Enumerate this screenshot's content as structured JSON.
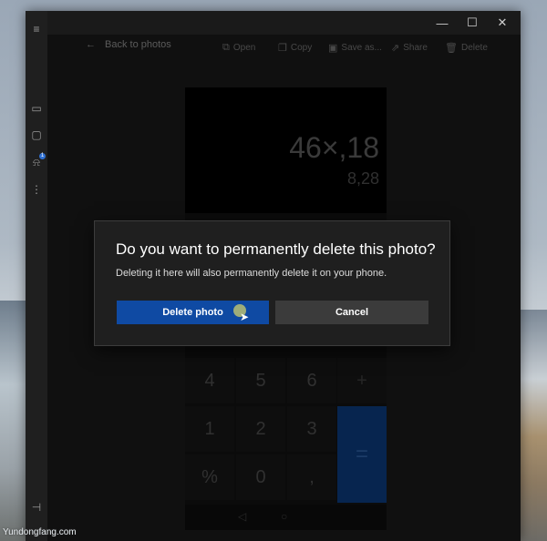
{
  "window": {
    "controls": {
      "minimize": "—",
      "maximize": "☐",
      "close": "✕"
    }
  },
  "rail": {
    "icons": [
      "gallery-icon",
      "message-icon",
      "bell-icon",
      "apps-grid-icon",
      "pin-icon"
    ],
    "notification_badge": "1"
  },
  "header": {
    "back_label": "Back to photos"
  },
  "toolbar": {
    "open_label": "Open",
    "copy_label": "Copy",
    "save_label": "Save as...",
    "share_label": "Share",
    "delete_label": "Delete"
  },
  "photo": {
    "expression": "46×,18",
    "result": "8,28",
    "keys": [
      [
        "4",
        "5",
        "6",
        "+"
      ],
      [
        "1",
        "2",
        "3",
        "="
      ],
      [
        "%",
        "0",
        ","
      ]
    ]
  },
  "dialog": {
    "title": "Do you want to permanently delete this photo?",
    "body": "Deleting it here will also permanently delete it on your phone.",
    "primary_label": "Delete photo",
    "secondary_label": "Cancel"
  },
  "watermark": "Yundongfang.com",
  "colors": {
    "primary_button": "#0f4aa3",
    "secondary_button": "#3b3b3b",
    "dialog_bg": "#1f1f1f",
    "app_bg": "#1a1a1a"
  }
}
